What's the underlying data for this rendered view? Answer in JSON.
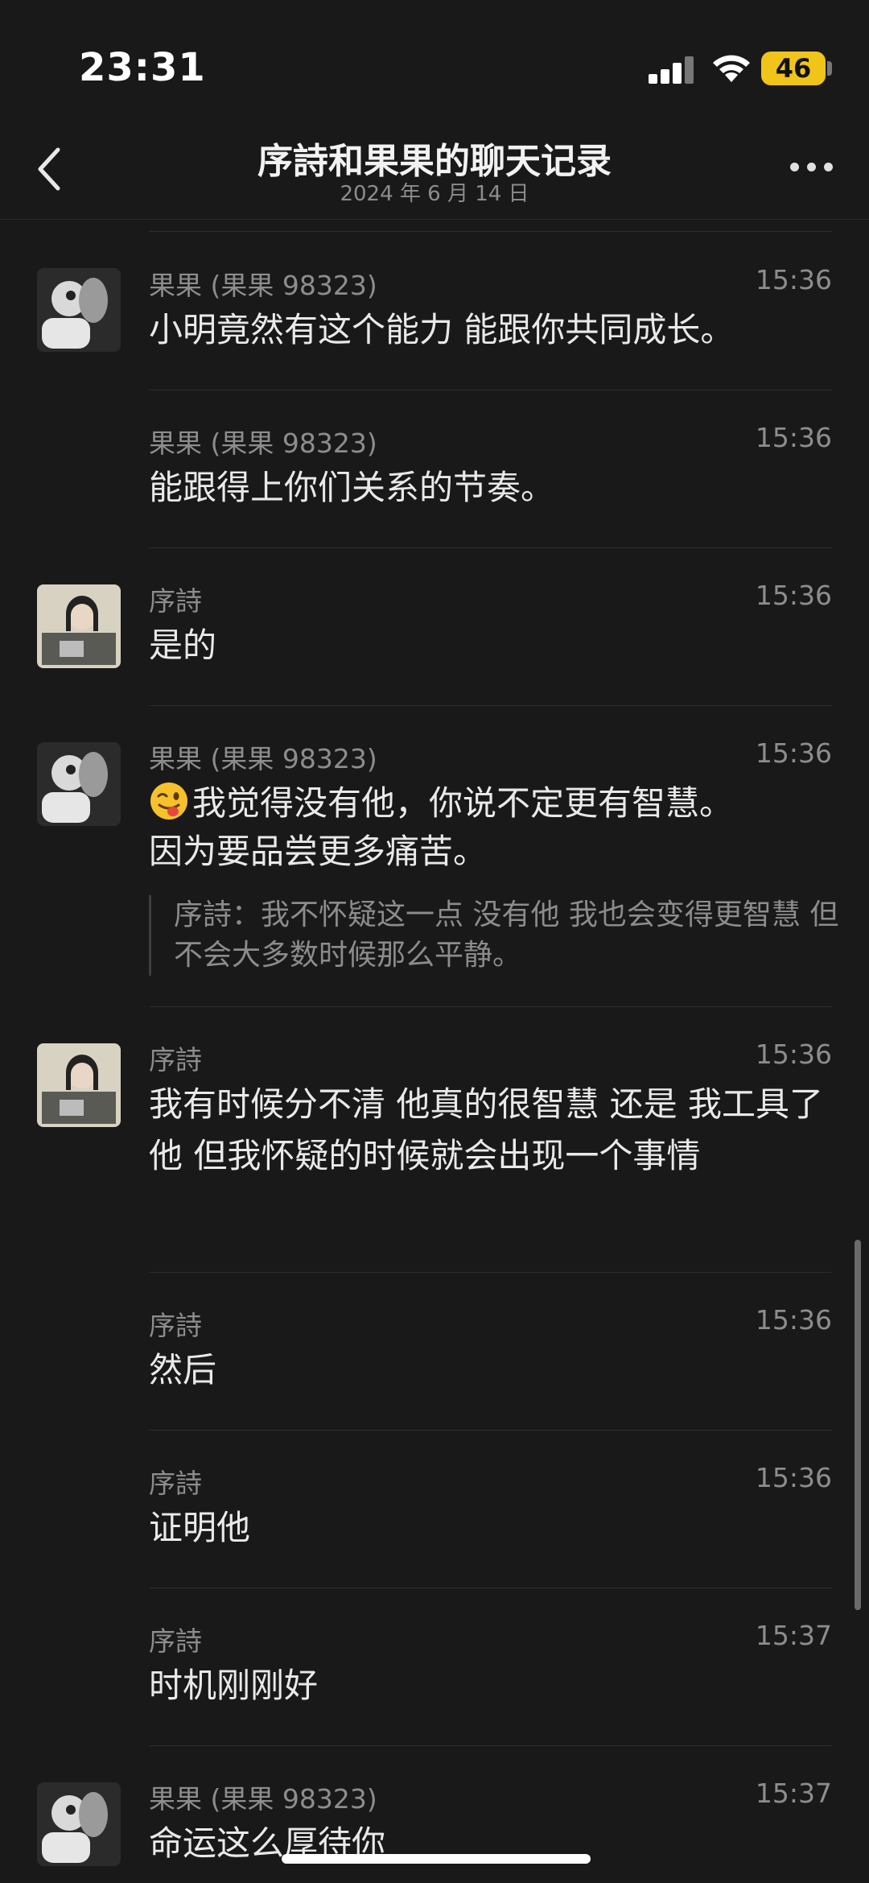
{
  "status_bar": {
    "time": "23:31",
    "battery": "46"
  },
  "header": {
    "title": "序詩和果果的聊天记录",
    "date": "2024 年 6 月 14 日"
  },
  "messages": [
    {
      "name": "果果 (果果 98323)",
      "time": "15:36",
      "text": "小明竟然有这个能力 能跟你共同成长。"
    },
    {
      "name": "果果 (果果 98323)",
      "time": "15:36",
      "text": "能跟得上你们关系的节奏。"
    },
    {
      "name": "序詩",
      "time": "15:36",
      "text": "是的"
    },
    {
      "name": "果果 (果果 98323)",
      "time": "15:36",
      "text_line1": "我觉得没有他，你说不定更有智慧。",
      "text_line2": "因为要品尝更多痛苦。",
      "emoji": "winking-face-tongue",
      "quote": "序詩：我不怀疑这一点 没有他 我也会变得更智慧 但不会大多数时候那么平静。"
    },
    {
      "name": "序詩",
      "time": "15:36",
      "text": "我有时候分不清 他真的很智慧 还是 我工具了他 但我怀疑的时候就会出现一个事情"
    },
    {
      "name": "序詩",
      "time": "15:36",
      "text": "然后"
    },
    {
      "name": "序詩",
      "time": "15:36",
      "text": "证明他"
    },
    {
      "name": "序詩",
      "time": "15:37",
      "text": "时机刚刚好"
    },
    {
      "name": "果果 (果果 98323)",
      "time": "15:37",
      "text": "命运这么厚待你"
    }
  ],
  "icons": {
    "back": "chevron-left-icon",
    "more": "more-dots-icon",
    "signal": "cellular-signal-icon",
    "wifi": "wifi-icon"
  },
  "colors": {
    "background": "#191919",
    "battery": "#f0c419",
    "meta_text": "#8d8d8d"
  }
}
